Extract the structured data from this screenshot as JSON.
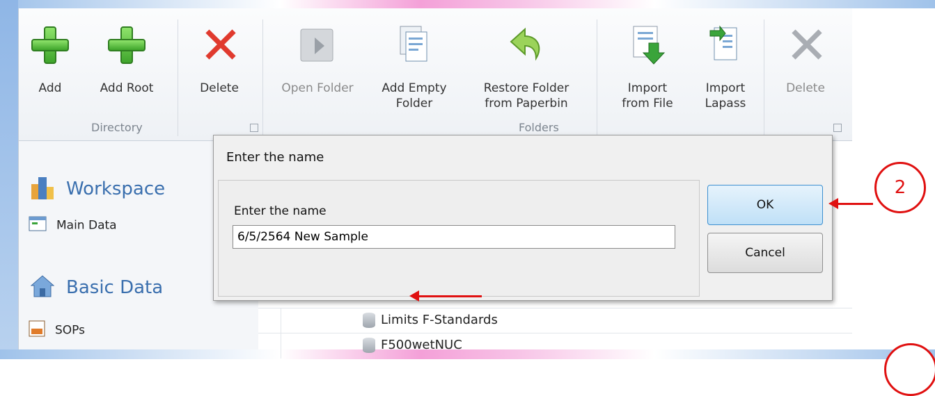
{
  "ribbon": {
    "directory": {
      "label": "Directory",
      "buttons": [
        {
          "label": "Add",
          "icon": "plus-icon"
        },
        {
          "label": "Add Root",
          "icon": "plus-icon"
        },
        {
          "label": "Delete",
          "icon": "delete-x-icon"
        }
      ]
    },
    "folders": {
      "label": "Folders",
      "buttons": [
        {
          "label": "Open Folder",
          "icon": "open-folder-icon",
          "disabled": true
        },
        {
          "label": "Add Empty\nFolder",
          "icon": "add-empty-folder-icon"
        },
        {
          "label": "Restore Folder\nfrom Paperbin",
          "icon": "restore-arrow-icon"
        },
        {
          "label": "Import\nfrom File",
          "icon": "import-file-icon"
        },
        {
          "label": "Import\nLapass",
          "icon": "import-lapass-icon"
        },
        {
          "label": "Delete",
          "icon": "delete-x-icon",
          "disabled": true
        }
      ]
    }
  },
  "nav": {
    "workspace": {
      "label": "Workspace",
      "items": [
        {
          "label": "Main Data"
        }
      ]
    },
    "basic_data": {
      "label": "Basic Data",
      "items": [
        {
          "label": "SOPs"
        }
      ]
    }
  },
  "list": {
    "rows": [
      {
        "label": "Limits F-Standards"
      },
      {
        "label": "F500wetNUC"
      }
    ]
  },
  "dialog": {
    "title": "Enter the name",
    "prompt": "Enter the name",
    "value": "6/5/2564 New Sample",
    "ok_label": "OK",
    "cancel_label": "Cancel"
  },
  "annotations": {
    "step_2": "2",
    "color": "#e01010"
  }
}
